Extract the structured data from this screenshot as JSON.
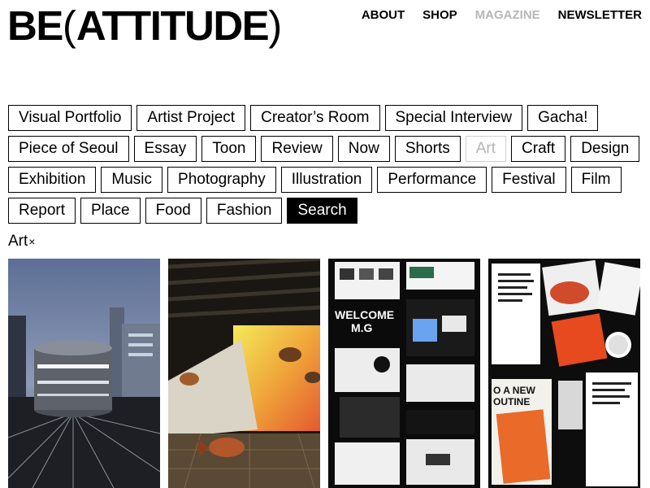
{
  "brand": {
    "prefix": "BE",
    "open_paren": "(",
    "name": "ATTITUDE",
    "close_paren": ")"
  },
  "nav": [
    {
      "label": "ABOUT",
      "state": "normal"
    },
    {
      "label": "SHOP",
      "state": "normal"
    },
    {
      "label": "MAGAZINE",
      "state": "muted"
    },
    {
      "label": "NEWSLETTER",
      "state": "normal"
    }
  ],
  "categories": [
    {
      "label": "Visual Portfolio",
      "state": "normal"
    },
    {
      "label": "Artist Project",
      "state": "normal"
    },
    {
      "label": "Creator’s Room",
      "state": "normal"
    },
    {
      "label": "Special Interview",
      "state": "normal"
    },
    {
      "label": "Gacha!",
      "state": "normal"
    },
    {
      "label": "Piece of Seoul",
      "state": "normal"
    },
    {
      "label": "Essay",
      "state": "normal"
    },
    {
      "label": "Toon",
      "state": "normal"
    },
    {
      "label": "Review",
      "state": "normal"
    },
    {
      "label": "Now",
      "state": "normal"
    },
    {
      "label": "Shorts",
      "state": "normal"
    },
    {
      "label": "Art",
      "state": "muted"
    },
    {
      "label": "Craft",
      "state": "normal"
    },
    {
      "label": "Design",
      "state": "normal"
    },
    {
      "label": "Exhibition",
      "state": "normal"
    },
    {
      "label": "Music",
      "state": "normal"
    },
    {
      "label": "Photography",
      "state": "normal"
    },
    {
      "label": "Illustration",
      "state": "normal"
    },
    {
      "label": "Performance",
      "state": "normal"
    },
    {
      "label": "Festival",
      "state": "normal"
    },
    {
      "label": "Film",
      "state": "normal"
    },
    {
      "label": "Report",
      "state": "normal"
    },
    {
      "label": "Place",
      "state": "normal"
    },
    {
      "label": "Food",
      "state": "normal"
    },
    {
      "label": "Fashion",
      "state": "normal"
    },
    {
      "label": "Search",
      "state": "active"
    }
  ],
  "active_filter": {
    "label": "Art",
    "remove_symbol": "×"
  },
  "thumbnails": [
    {
      "name": "thumb-night-city-installation"
    },
    {
      "name": "thumb-gallery-fish-sculptures"
    },
    {
      "name": "thumb-web-design-collage",
      "texts": [
        "WELCOME",
        "M.G"
      ]
    },
    {
      "name": "thumb-posters-collage",
      "texts": [
        "O A NEW",
        "OUTINE"
      ]
    }
  ],
  "colors": {
    "text": "#000000",
    "muted": "#b7b7b7",
    "active_bg": "#000000",
    "active_text": "#ffffff"
  }
}
